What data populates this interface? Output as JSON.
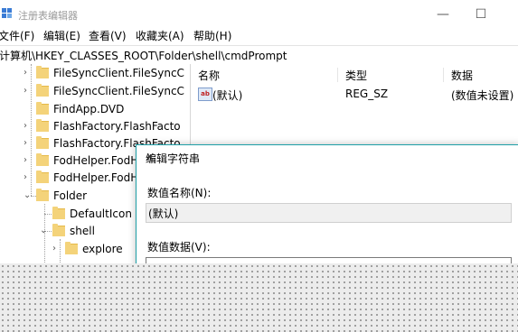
{
  "window": {
    "title": "注册表编辑器",
    "minimize": "—",
    "maximize": "☐"
  },
  "menu": [
    "文件(F)",
    "编辑(E)",
    "查看(V)",
    "收藏夹(A)",
    "帮助(H)"
  ],
  "address": "计算机\\HKEY_CLASSES_ROOT\\Folder\\shell\\cmdPrompt",
  "tree": [
    {
      "label": "FileSyncClient.FileSyncC",
      "expander": "›"
    },
    {
      "label": "FileSyncClient.FileSyncC",
      "expander": "›"
    },
    {
      "label": "FindApp.DVD",
      "expander": ""
    },
    {
      "label": "FlashFactory.FlashFacto",
      "expander": "›"
    },
    {
      "label": "FlashFactory.FlashFacto",
      "expander": "›"
    },
    {
      "label": "FodHelper.FodH",
      "expander": "›"
    },
    {
      "label": "FodHelper.FodH",
      "expander": "›"
    },
    {
      "label": "Folder",
      "expander": "⌄"
    },
    {
      "label": "DefaultIcon",
      "expander": ""
    },
    {
      "label": "shell",
      "expander": "⌄"
    },
    {
      "label": "explore",
      "expander": "›"
    }
  ],
  "list": {
    "headers": {
      "name": "名称",
      "type": "类型",
      "data": "数据"
    },
    "rows": [
      {
        "icon": "ab",
        "name": "(默认)",
        "type": "REG_SZ",
        "data": "(数值未设置)"
      }
    ]
  },
  "dialog": {
    "title": "编辑字符串",
    "close": "✕",
    "name_label": "数值名称(N):",
    "name_value": "(默认)",
    "data_label": "数值数据(V):",
    "data_value": ""
  },
  "colors": {
    "dialog_border": "#1ea0a8",
    "folder": "#f4d37a"
  }
}
